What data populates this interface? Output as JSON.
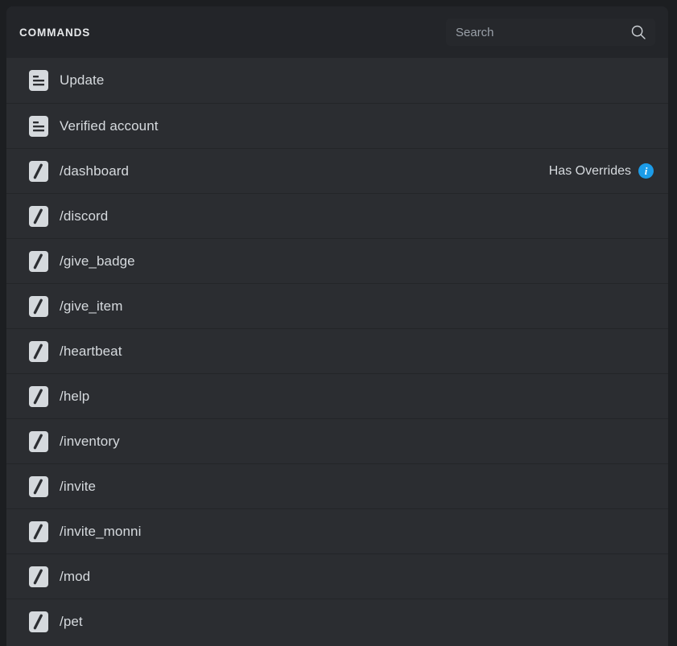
{
  "header": {
    "title": "COMMANDS",
    "search": {
      "placeholder": "Search",
      "value": "",
      "icon": "search-icon"
    }
  },
  "colors": {
    "page_background": "#1c1e21",
    "card_background": "#2b2d31",
    "header_background": "#232529",
    "divider": "#232528",
    "text_primary": "#d6dade",
    "text_placeholder": "#9aa0a8",
    "icon_tile": "#d5d9dd",
    "icon_glyph": "#2b2d31",
    "info_badge": "#1c9ce8"
  },
  "list": {
    "items": [
      {
        "label": "Update",
        "icon": "message-document-icon",
        "badge": null
      },
      {
        "label": "Verified account",
        "icon": "message-document-icon",
        "badge": null
      },
      {
        "label": "/dashboard",
        "icon": "slash-command-icon",
        "badge": {
          "text": "Has Overrides",
          "icon": "info-icon"
        }
      },
      {
        "label": "/discord",
        "icon": "slash-command-icon",
        "badge": null
      },
      {
        "label": "/give_badge",
        "icon": "slash-command-icon",
        "badge": null
      },
      {
        "label": "/give_item",
        "icon": "slash-command-icon",
        "badge": null
      },
      {
        "label": "/heartbeat",
        "icon": "slash-command-icon",
        "badge": null
      },
      {
        "label": "/help",
        "icon": "slash-command-icon",
        "badge": null
      },
      {
        "label": "/inventory",
        "icon": "slash-command-icon",
        "badge": null
      },
      {
        "label": "/invite",
        "icon": "slash-command-icon",
        "badge": null
      },
      {
        "label": "/invite_monni",
        "icon": "slash-command-icon",
        "badge": null
      },
      {
        "label": "/mod",
        "icon": "slash-command-icon",
        "badge": null
      },
      {
        "label": "/pet",
        "icon": "slash-command-icon",
        "badge": null
      }
    ]
  }
}
